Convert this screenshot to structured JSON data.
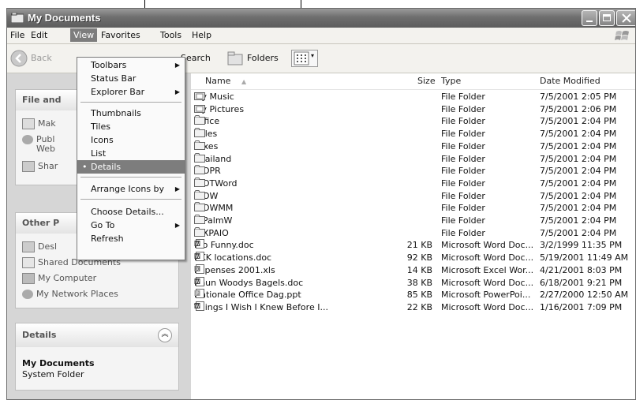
{
  "window": {
    "title": "My Documents"
  },
  "menubar": [
    "File",
    "Edit",
    "View",
    "Favorites",
    "Tools",
    "Help"
  ],
  "toolbar": {
    "back": "Back",
    "search": "Search",
    "folders": "Folders"
  },
  "view_menu": {
    "items": [
      "Toolbars",
      "Status Bar",
      "Explorer Bar",
      "Thumbnails",
      "Tiles",
      "Icons",
      "List",
      "Details",
      "Arrange Icons by",
      "Choose Details...",
      "Go To",
      "Refresh"
    ],
    "selected": "Details"
  },
  "tasks": {
    "file_panel": {
      "title": "File and",
      "items": [
        "Mak",
        "Publ",
        "Web",
        "Shar"
      ]
    },
    "other_panel": {
      "title": "Other P",
      "items": [
        "Desl",
        "Shared Documents",
        "My Computer",
        "My Network Places"
      ]
    },
    "details": {
      "title": "Details",
      "name": "My Documents",
      "subtitle": "System Folder"
    }
  },
  "columns": [
    "Name",
    "Size",
    "Type",
    "Date Modified"
  ],
  "files": [
    {
      "name": "My Music",
      "size": "",
      "type": "File Folder",
      "date": "7/5/2001 2:05 PM",
      "icon": "special-folder-icon"
    },
    {
      "name": "My Pictures",
      "size": "",
      "type": "File Folder",
      "date": "7/5/2001 2:06 PM",
      "icon": "special-folder-icon"
    },
    {
      "name": "Office",
      "size": "",
      "type": "File Folder",
      "date": "7/5/2001 2:04 PM",
      "icon": "folder-icon"
    },
    {
      "name": "Sales",
      "size": "",
      "type": "File Folder",
      "date": "7/5/2001 2:04 PM",
      "icon": "folder-icon"
    },
    {
      "name": "Taxes",
      "size": "",
      "type": "File Folder",
      "date": "7/5/2001 2:04 PM",
      "icon": "folder-icon"
    },
    {
      "name": "Thailand",
      "size": "",
      "type": "File Folder",
      "date": "7/5/2001 2:04 PM",
      "icon": "folder-icon"
    },
    {
      "name": "WOPR",
      "size": "",
      "type": "File Folder",
      "date": "7/5/2001 2:04 PM",
      "icon": "folder-icon"
    },
    {
      "name": "WOTWord",
      "size": "",
      "type": "File Folder",
      "date": "7/5/2001 2:04 PM",
      "icon": "folder-icon"
    },
    {
      "name": "WOW",
      "size": "",
      "type": "File Folder",
      "date": "7/5/2001 2:04 PM",
      "icon": "folder-icon"
    },
    {
      "name": "WOWMM",
      "size": "",
      "type": "File Folder",
      "date": "7/5/2001 2:04 PM",
      "icon": "folder-icon"
    },
    {
      "name": "WPalmW",
      "size": "",
      "type": "File Folder",
      "date": "7/5/2001 2:04 PM",
      "icon": "folder-icon"
    },
    {
      "name": "WXPAIO",
      "size": "",
      "type": "File Folder",
      "date": "7/5/2001 2:04 PM",
      "icon": "folder-icon"
    },
    {
      "name": "Bio Funny.doc",
      "size": "21 KB",
      "type": "Microsoft Word Doc...",
      "date": "3/2/1999 11:35 PM",
      "icon": "word-doc-icon"
    },
    {
      "name": "BKK locations.doc",
      "size": "92 KB",
      "type": "Microsoft Word Doc...",
      "date": "5/19/2001 11:49 AM",
      "icon": "word-doc-icon"
    },
    {
      "name": "Expenses 2001.xls",
      "size": "14 KB",
      "type": "Microsoft Excel Wor...",
      "date": "4/21/2001 8:03 PM",
      "icon": "excel-doc-icon"
    },
    {
      "name": "Khun Woodys Bagels.doc",
      "size": "38 KB",
      "type": "Microsoft Word Doc...",
      "date": "6/18/2001 9:21 PM",
      "icon": "word-doc-icon"
    },
    {
      "name": "Nationale Office Dag.ppt",
      "size": "85 KB",
      "type": "Microsoft PowerPoi...",
      "date": "2/27/2000 12:50 AM",
      "icon": "powerpoint-doc-icon"
    },
    {
      "name": "Things I Wish I Knew Before I...",
      "size": "22 KB",
      "type": "Microsoft Word Doc...",
      "date": "1/16/2001 7:09 PM",
      "icon": "word-doc-icon"
    }
  ]
}
